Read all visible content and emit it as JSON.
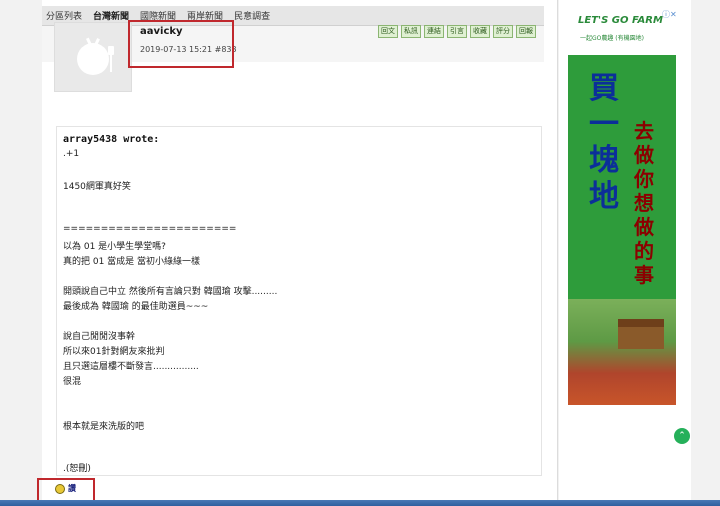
{
  "nav": {
    "items": [
      "分區列表",
      "台灣新聞",
      "國際新聞",
      "兩岸新聞",
      "民意調查"
    ],
    "active_index": 1
  },
  "post": {
    "username": "aavicky",
    "datetime": "2019-07-13 15:21",
    "post_number": "#833",
    "actions": [
      "回文",
      "私訊",
      "連結",
      "引言",
      "收藏",
      "評分",
      "回報"
    ]
  },
  "content": {
    "quote_author": "array5438 wrote:",
    "lines": [
      ".+1",
      "",
      "1450網軍真好笑",
      "",
      "",
      "=======================",
      "以為 01 是小學生學堂嗎?",
      "真的把 01 當成是 當初小綠綠一樣",
      "",
      "開頭說自己中立 然後所有言論只對 韓國瑜 攻擊.........",
      "最後成為 韓國瑜 的最佳助選員~~~",
      "",
      "說自己閒閒沒事幹",
      "所以來01針對網友來批判",
      "且只選這層樓不斷發言................",
      "很混",
      "",
      "",
      "根本就是來洗版的吧",
      "",
      "",
      ".(恕刪)"
    ]
  },
  "like": {
    "label": "讚"
  },
  "ad": {
    "logo": "LET'S GO FARM",
    "subtitle": "一起GO農趣 (有機園地)",
    "close": "ⓘ✕",
    "col1": [
      "買",
      "一",
      "塊",
      "地"
    ],
    "col2": [
      "去",
      "做",
      "你",
      "想",
      "做",
      "的",
      "事"
    ]
  },
  "floating": {
    "icon": "chevron-up-icon",
    "glyph": "⌃"
  },
  "colors": {
    "highlight": "#c0282d",
    "action_button_bg": "#dff0d2",
    "ad_green": "#2e9c3b"
  }
}
